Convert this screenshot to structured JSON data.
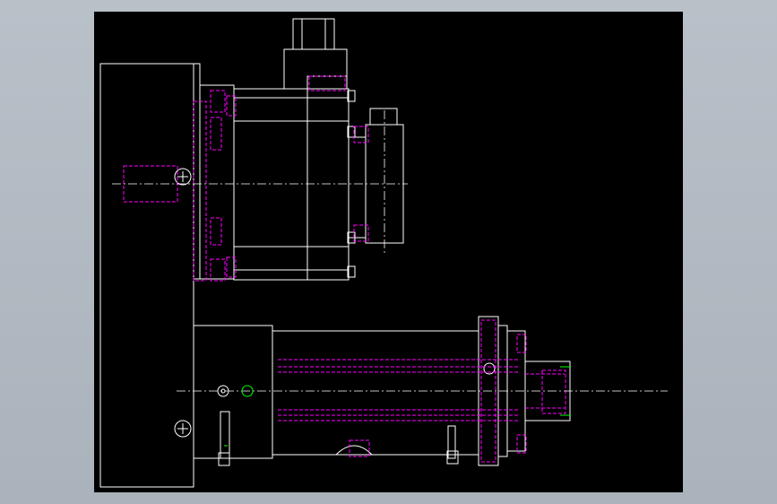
{
  "viewer": {
    "background_color": "#b7bec6",
    "drawing_background": "#000000"
  },
  "drawing": {
    "layer_colors": {
      "outline": "#ffffff",
      "hidden": "#ff00ff",
      "center": "#ffffff",
      "dimension": "#00ff00"
    },
    "annotations": []
  }
}
